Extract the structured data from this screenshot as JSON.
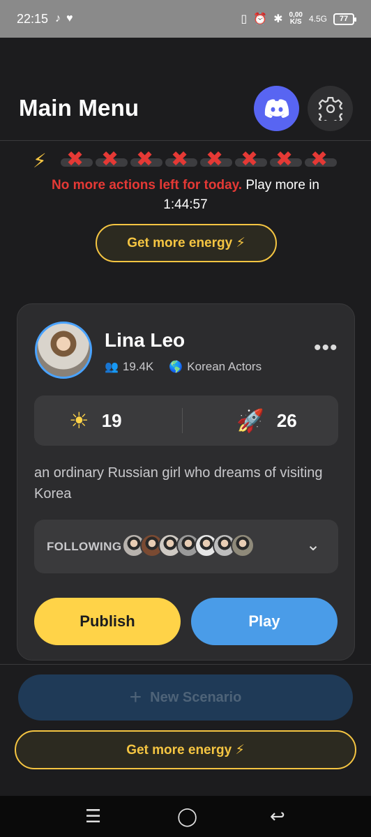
{
  "status_bar": {
    "time": "22:15",
    "net_speed_value": "0,00",
    "net_speed_unit": "K/S",
    "network": "4.5G",
    "battery": "77"
  },
  "header": {
    "title": "Main Menu"
  },
  "energy": {
    "slots": 8,
    "remaining": 0,
    "message_warn": "No more actions left for today.",
    "message_rest": " Play more in 1:44:57",
    "button_label": "Get more energy ⚡"
  },
  "character": {
    "name": "Lina Leo",
    "followers": "19.4K",
    "category": "Korean Actors",
    "stat_sun": "19",
    "stat_rocket": "26",
    "description": "an ordinary Russian girl who dreams of visiting Korea",
    "following_label": "FOLLOWING",
    "following_count_shown": 7,
    "publish_label": "Publish",
    "play_label": "Play"
  },
  "footer": {
    "new_scenario_label": "New Scenario",
    "energy_button_label": "Get more energy ⚡"
  },
  "colors": {
    "background": "#1c1c1e",
    "card": "#2c2c2e",
    "accent_yellow": "#ffd348",
    "accent_blue": "#4a9ce8",
    "discord": "#5865f2",
    "warning_red": "#e53935"
  }
}
